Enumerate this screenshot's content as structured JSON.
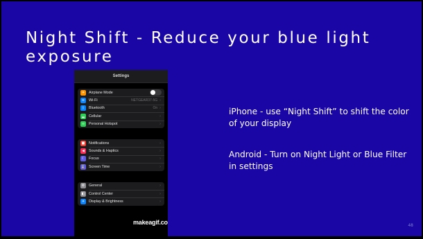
{
  "slide": {
    "title_line1": "Night Shift - Reduce your blue light",
    "title_line2": "exposure",
    "body_p1": "iPhone - use “Night Shift” to shift the color of your display",
    "body_p2": "Android - Turn on Night Light or Blue Filter in settings",
    "page_number": "48",
    "background_color": "#1a06a5"
  },
  "phone": {
    "header_title": "Settings",
    "groups": [
      [
        {
          "label": "Airplane Mode",
          "icon": "airplane-icon",
          "icon_color": "#ff9500",
          "glyph": "✈",
          "toggle": "off"
        },
        {
          "label": "Wi-Fi",
          "icon": "wifi-icon",
          "icon_color": "#0a84ff",
          "glyph": "≋",
          "value": "NETGEAR37-5G"
        },
        {
          "label": "Bluetooth",
          "icon": "bluetooth-icon",
          "icon_color": "#0a84ff",
          "glyph": "ᛒ",
          "value": "On"
        },
        {
          "label": "Cellular",
          "icon": "cellular-icon",
          "icon_color": "#30d158",
          "glyph": "▂"
        },
        {
          "label": "Personal Hotspot",
          "icon": "hotspot-icon",
          "icon_color": "#30d158",
          "glyph": "∞"
        }
      ],
      [
        {
          "label": "Notifications",
          "icon": "notifications-icon",
          "icon_color": "#ff3b30",
          "glyph": "■"
        },
        {
          "label": "Sounds & Haptics",
          "icon": "sounds-icon",
          "icon_color": "#ff2d55",
          "glyph": "◀"
        },
        {
          "label": "Focus",
          "icon": "focus-moon-icon",
          "icon_color": "#5e5ce6",
          "glyph": "☾"
        },
        {
          "label": "Screen Time",
          "icon": "hourglass-icon",
          "icon_color": "#5e5ce6",
          "glyph": "⌛"
        }
      ],
      [
        {
          "label": "General",
          "icon": "gear-icon",
          "icon_color": "#8e8e93",
          "glyph": "⚙"
        },
        {
          "label": "Control Center",
          "icon": "control-center-icon",
          "icon_color": "#8e8e93",
          "glyph": "◧"
        },
        {
          "label": "Display & Brightness",
          "icon": "display-icon",
          "icon_color": "#0a84ff",
          "glyph": "☀"
        }
      ]
    ]
  },
  "watermark": "makeagif.com"
}
